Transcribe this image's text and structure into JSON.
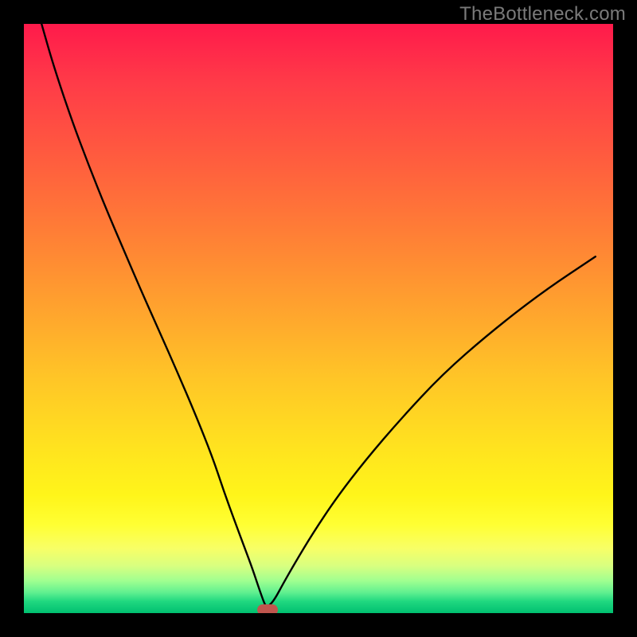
{
  "watermark": "TheBottleneck.com",
  "colors": {
    "background": "#000000",
    "watermark": "#7a7a7a",
    "curve": "#000000",
    "marker": "#c0564e"
  },
  "chart_data": {
    "type": "line",
    "title": "",
    "xlabel": "",
    "ylabel": "",
    "xlim": [
      0,
      100
    ],
    "ylim": [
      0,
      100
    ],
    "grid": false,
    "legend": false,
    "x": [
      3,
      5,
      8,
      11,
      14,
      17,
      20,
      23,
      26,
      29,
      32,
      34,
      36,
      37.5,
      38.8,
      39.8,
      40.5,
      41,
      41.6,
      42.6,
      44,
      46,
      49,
      53,
      58,
      64,
      71,
      79,
      88,
      97
    ],
    "values": [
      100,
      93,
      84,
      76,
      68.5,
      61.5,
      54.5,
      47.8,
      41,
      34,
      26.5,
      20.5,
      15,
      11,
      7.5,
      4.5,
      2.5,
      1.2,
      1.2,
      2.4,
      5,
      8.5,
      13.5,
      19.5,
      26,
      33,
      40.5,
      47.5,
      54.5,
      60.5
    ],
    "marker": {
      "x": 41.3,
      "y": 0.5
    }
  }
}
